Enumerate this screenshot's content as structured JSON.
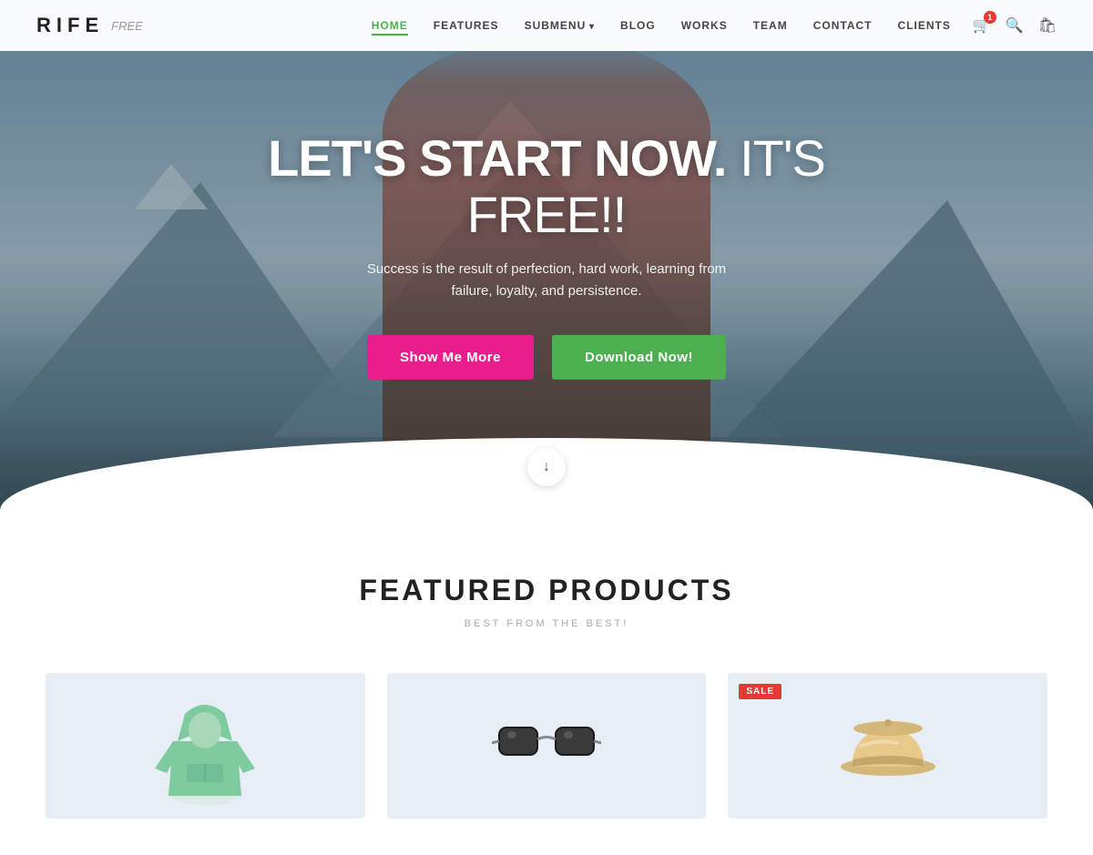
{
  "brand": {
    "name": "RIFE",
    "tagline": "free"
  },
  "nav": {
    "links": [
      {
        "id": "home",
        "label": "HOME",
        "active": true,
        "has_dropdown": false
      },
      {
        "id": "features",
        "label": "FEATURES",
        "active": false,
        "has_dropdown": false
      },
      {
        "id": "submenu",
        "label": "SUBMENU",
        "active": false,
        "has_dropdown": true
      },
      {
        "id": "blog",
        "label": "BLOG",
        "active": false,
        "has_dropdown": false
      },
      {
        "id": "works",
        "label": "WORKS",
        "active": false,
        "has_dropdown": false
      },
      {
        "id": "team",
        "label": "TEAM",
        "active": false,
        "has_dropdown": false
      },
      {
        "id": "contact",
        "label": "CONTACT",
        "active": false,
        "has_dropdown": false
      },
      {
        "id": "clients",
        "label": "CLIENTS",
        "active": false,
        "has_dropdown": false
      }
    ],
    "cart_count": "1"
  },
  "hero": {
    "title_bold": "LET'S START NOW.",
    "title_light": "IT'S FREE!!",
    "subtitle": "Success is the result of perfection, hard work, learning from failure, loyalty, and persistence.",
    "btn_show": "Show Me More",
    "btn_download": "Download Now!"
  },
  "products": {
    "section_title": "FEATURED PRODUCTS",
    "section_subtitle": "BEST FROM THE BEST!",
    "items": [
      {
        "id": "hoodie",
        "type": "hoodie",
        "sale": false
      },
      {
        "id": "glasses",
        "type": "glasses",
        "sale": false
      },
      {
        "id": "hat",
        "type": "hat",
        "sale": true
      }
    ],
    "sale_label": "SALE"
  },
  "colors": {
    "accent_green": "#4caf50",
    "accent_pink": "#e91e8c",
    "accent_red": "#e53935"
  }
}
